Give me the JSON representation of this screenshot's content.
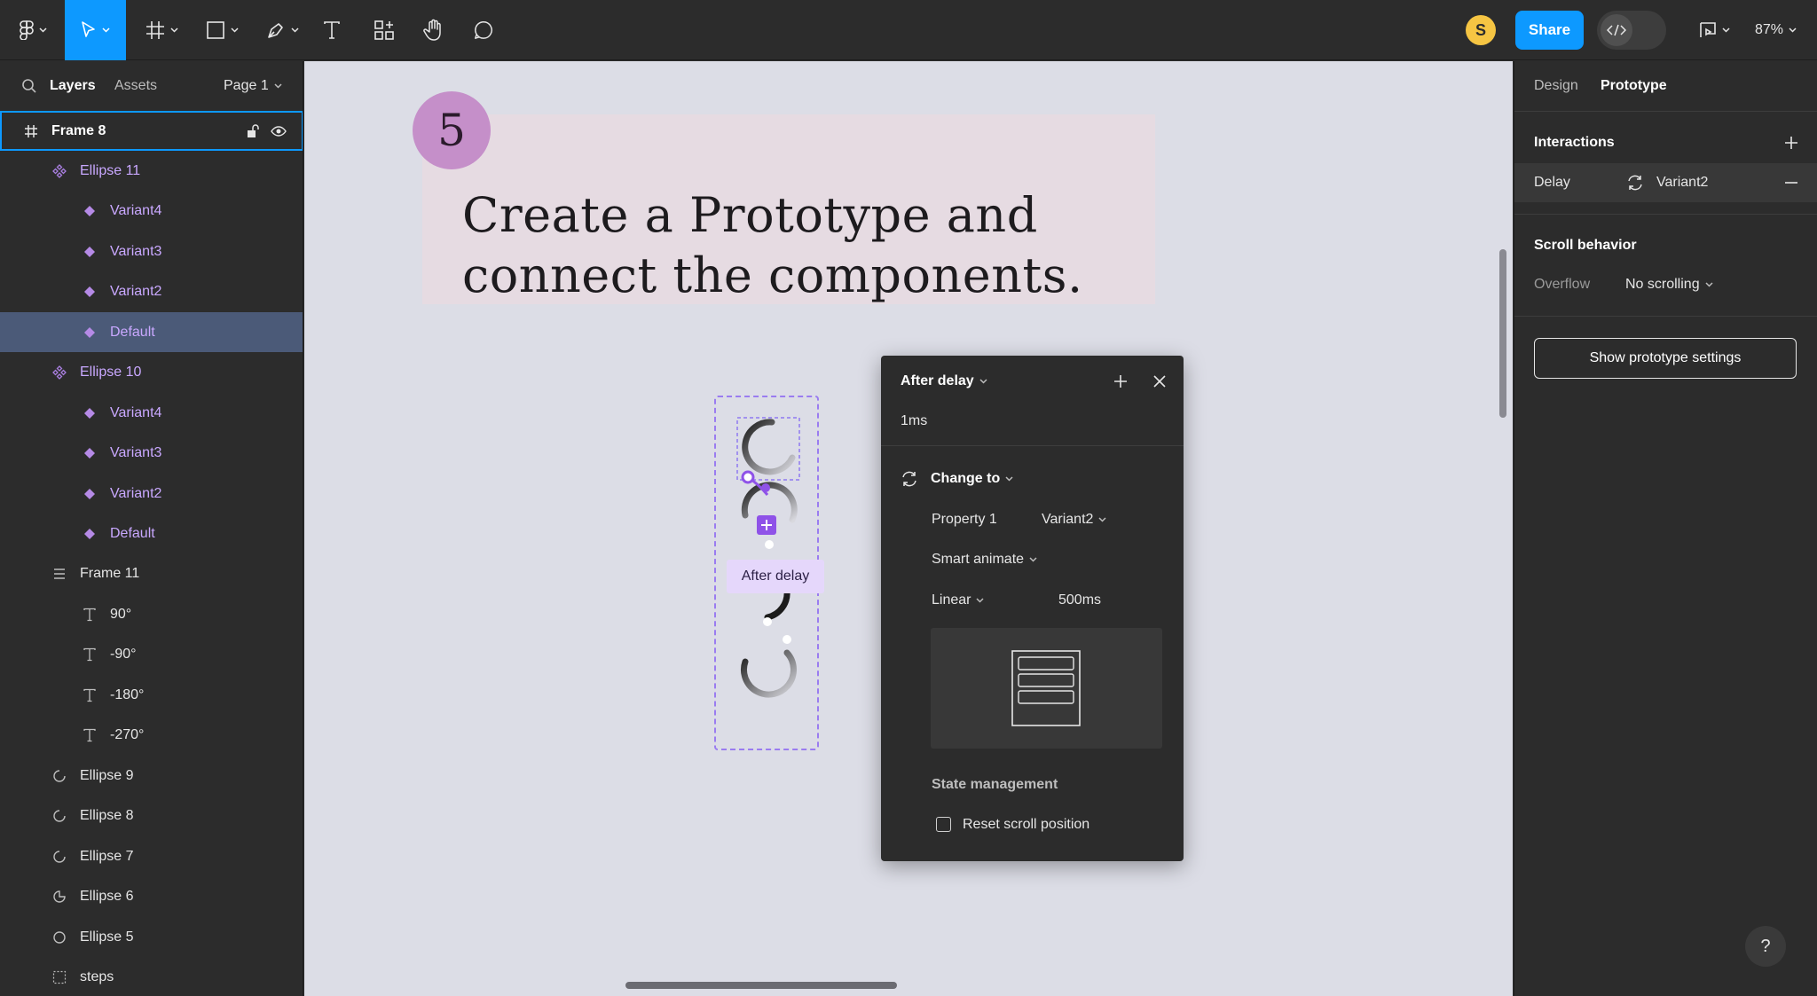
{
  "toolbar": {
    "zoom": "87%",
    "avatar_initial": "S",
    "share_label": "Share",
    "icons": [
      "figma-menu-icon",
      "move-tool-icon",
      "frame-tool-icon",
      "shape-tool-icon",
      "pen-tool-icon",
      "text-tool-icon",
      "resources-icon",
      "hand-tool-icon",
      "comment-icon",
      "dev-mode-icon",
      "present-icon"
    ]
  },
  "left_panel": {
    "tabs": {
      "layers": "Layers",
      "assets": "Assets",
      "page": "Page 1"
    },
    "layers": [
      {
        "name": "Frame 8",
        "icon": "frame-icon",
        "level": 0,
        "selected_frame": true
      },
      {
        "name": "Ellipse 11",
        "icon": "component-set-icon",
        "level": 1,
        "purple": true
      },
      {
        "name": "Variant4",
        "icon": "variant-icon",
        "level": 2,
        "purple": true
      },
      {
        "name": "Variant3",
        "icon": "variant-icon",
        "level": 2,
        "purple": true
      },
      {
        "name": "Variant2",
        "icon": "variant-icon",
        "level": 2,
        "purple": true
      },
      {
        "name": "Default",
        "icon": "variant-icon",
        "level": 2,
        "purple": true,
        "selected": true
      },
      {
        "name": "Ellipse 10",
        "icon": "component-set-icon",
        "level": 1,
        "purple": true
      },
      {
        "name": "Variant4",
        "icon": "variant-icon",
        "level": 2,
        "purple": true
      },
      {
        "name": "Variant3",
        "icon": "variant-icon",
        "level": 2,
        "purple": true
      },
      {
        "name": "Variant2",
        "icon": "variant-icon",
        "level": 2,
        "purple": true
      },
      {
        "name": "Default",
        "icon": "variant-icon",
        "level": 2,
        "purple": true
      },
      {
        "name": "Frame 11",
        "icon": "auto-layout-icon",
        "level": 1
      },
      {
        "name": "90°",
        "icon": "text-layer-icon",
        "level": 2
      },
      {
        "name": "-90°",
        "icon": "text-layer-icon",
        "level": 2
      },
      {
        "name": "-180°",
        "icon": "text-layer-icon",
        "level": 2
      },
      {
        "name": "-270°",
        "icon": "text-layer-icon",
        "level": 2
      },
      {
        "name": "Ellipse 9",
        "icon": "arc-icon",
        "level": 1
      },
      {
        "name": "Ellipse 8",
        "icon": "arc-icon",
        "level": 1
      },
      {
        "name": "Ellipse 7",
        "icon": "arc-icon",
        "level": 1
      },
      {
        "name": "Ellipse 6",
        "icon": "pie-icon",
        "level": 1
      },
      {
        "name": "Ellipse 5",
        "icon": "ellipse-icon",
        "level": 1
      },
      {
        "name": "steps",
        "icon": "grid-frame-icon",
        "level": 1
      }
    ]
  },
  "canvas": {
    "step_number": "5",
    "title_line1": "Create a Prototype and",
    "title_line2": "connect the components.",
    "delay_label": "After delay"
  },
  "popup": {
    "trigger": "After delay",
    "delay_value": "1ms",
    "action": "Change to",
    "property_label": "Property 1",
    "property_value": "Variant2",
    "animation": "Smart animate",
    "easing": "Linear",
    "duration": "500ms",
    "state_management": "State management",
    "reset_scroll": "Reset scroll position",
    "reset_scroll_checked": false
  },
  "right_panel": {
    "tabs": {
      "design": "Design",
      "prototype": "Prototype"
    },
    "interactions_header": "Interactions",
    "interaction": {
      "trigger": "Delay",
      "target": "Variant2"
    },
    "scroll_header": "Scroll behavior",
    "overflow_label": "Overflow",
    "overflow_value": "No scrolling",
    "settings_button": "Show prototype settings",
    "help": "?"
  },
  "colors": {
    "accent": "#0d99ff",
    "component_purple": "#c9a8ff",
    "canvas_bg": "#dcdde6",
    "step_circle": "#c58fc9",
    "title_card": "#e6dbe2"
  }
}
